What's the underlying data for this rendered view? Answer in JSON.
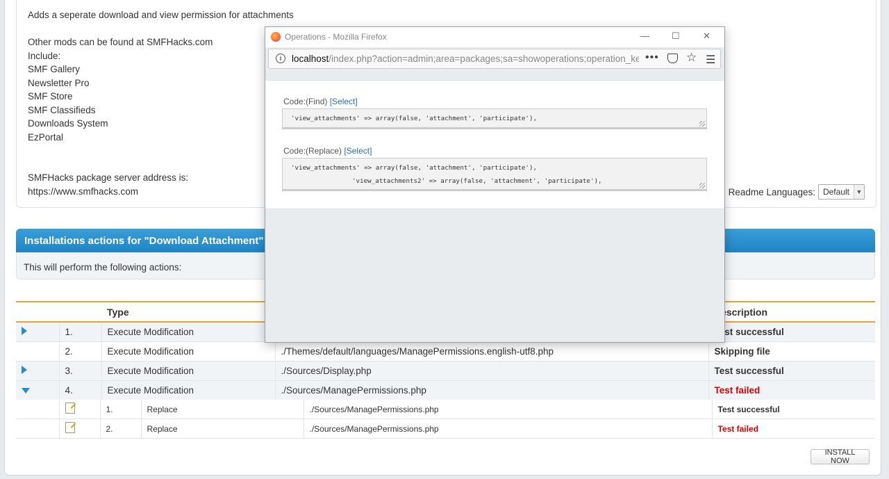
{
  "readme": {
    "lines": [
      "Adds a seperate download and view permission for attachments",
      "",
      "Other mods can be found at SMFHacks.com",
      "Include:",
      "SMF Gallery",
      "Newsletter Pro",
      "SMF Store",
      "SMF Classifieds",
      "Downloads System",
      "EzPortal",
      "",
      "",
      "SMFHacks package server address is:",
      "https://www.smfhacks.com"
    ],
    "languages_label": "Readme Languages:",
    "languages_value": "Default"
  },
  "install": {
    "title": "Installations actions for \"Download Attachment\"",
    "info": "This will perform the following actions:",
    "headers": {
      "type": "Type",
      "description": "Description"
    },
    "rows": [
      {
        "num": "1.",
        "type": "Execute Modification",
        "file": "",
        "status": "Test successful"
      },
      {
        "num": "2.",
        "type": "Execute Modification",
        "file": "./Themes/default/languages/ManagePermissions.english-utf8.php",
        "status": "Skipping file"
      },
      {
        "num": "3.",
        "type": "Execute Modification",
        "file": "./Sources/Display.php",
        "status": "Test successful"
      },
      {
        "num": "4.",
        "type": "Execute Modification",
        "file": "./Sources/ManagePermissions.php",
        "status": "Test failed"
      }
    ],
    "subrows": [
      {
        "num": "1.",
        "action": "Replace",
        "file": "./Sources/ManagePermissions.php",
        "status": "Test successful"
      },
      {
        "num": "2.",
        "action": "Replace",
        "file": "./Sources/ManagePermissions.php",
        "status": "Test failed"
      }
    ],
    "install_button": "INSTALL NOW"
  },
  "popup": {
    "window_title": "Operations - Mozilla Firefox",
    "url_host": "localhost",
    "url_rest": "/index.php?action=admin;area=packages;sa=showoperations;operation_key",
    "find_label": "Code:(Find)",
    "replace_label": "Code:(Replace)",
    "select_label": "[Select]",
    "find_code": "'view_attachments' => array(false, 'attachment', 'participate'),",
    "replace_code_1": "'view_attachments' => array(false, 'attachment', 'participate'),",
    "replace_code_2": "'view_attachments2' => array(false, 'attachment', 'participate'),"
  }
}
